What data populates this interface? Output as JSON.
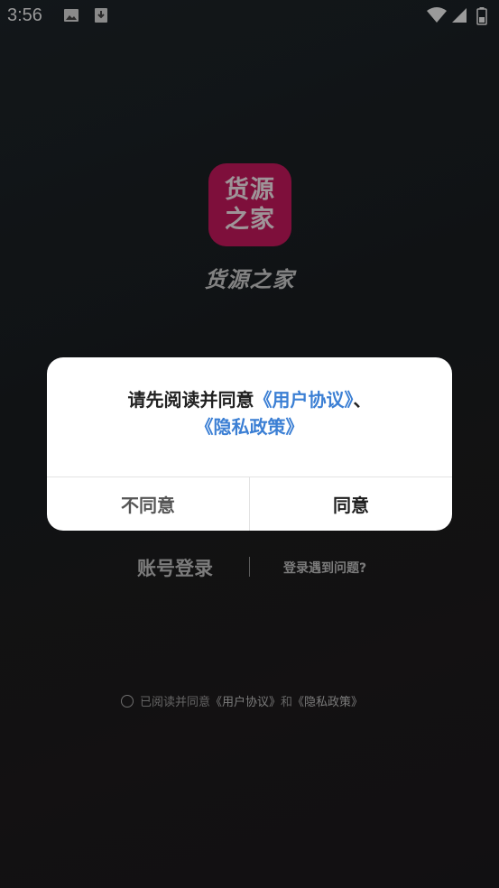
{
  "status_bar": {
    "time": "3:56",
    "icons": [
      "image-icon",
      "download-icon",
      "wifi-icon",
      "signal-icon",
      "battery-icon"
    ]
  },
  "app": {
    "logo_line1": "货源",
    "logo_line2": "之家",
    "logo_color": "#c2185b",
    "name": "货源之家"
  },
  "dialog": {
    "message_prefix": "请先阅读并同意",
    "user_agreement_link": "《用户协议》",
    "separator": "、",
    "privacy_policy_link": "《隐私政策》",
    "disagree_label": "不同意",
    "agree_label": "同意",
    "link_color": "#3b7fd4"
  },
  "login": {
    "account_login_label": "账号登录",
    "help_label": "登录遇到问题?"
  },
  "agreement": {
    "prefix": "已阅读并同意",
    "user_agreement": "《用户协议》",
    "and": "和",
    "privacy_policy": "《隐私政策》"
  }
}
